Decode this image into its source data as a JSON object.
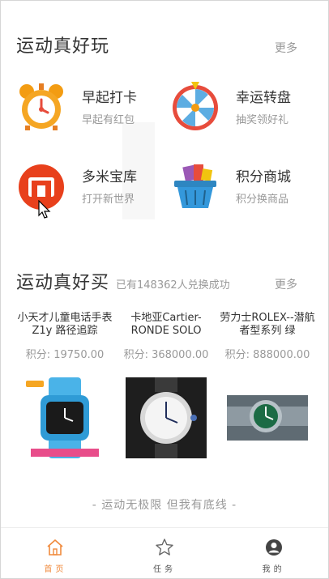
{
  "section_fun": {
    "title": "运动真好玩",
    "more": "更多",
    "items": [
      {
        "name": "早起打卡",
        "desc": "早起有红包",
        "icon": "alarm-clock-icon"
      },
      {
        "name": "幸运转盘",
        "desc": "抽奖领好礼",
        "icon": "lucky-wheel-icon"
      },
      {
        "name": "多米宝库",
        "desc": "打开新世界",
        "icon": "treasure-icon"
      },
      {
        "name": "积分商城",
        "desc": "积分换商品",
        "icon": "shopping-basket-icon"
      }
    ]
  },
  "section_buy": {
    "title": "运动真好买",
    "subtitle": "已有148362人兑换成功",
    "more": "更多",
    "products": [
      {
        "name": "小天才儿童电话手表 Z1y 路径追踪",
        "price": "积分: 19750.00",
        "icon": "kids-smartwatch-image"
      },
      {
        "name": "卡地亚Cartier-RONDE SOLO",
        "price": "积分: 368000.00",
        "icon": "cartier-watch-image"
      },
      {
        "name": "劳力士ROLEX--潜航者型系列 绿",
        "price": "积分: 888000.00",
        "icon": "rolex-watch-image"
      }
    ]
  },
  "slogan": "- 运动无极限 但我有底线 -",
  "tabs": [
    {
      "label": "首页",
      "icon": "home-icon",
      "active": true
    },
    {
      "label": "任务",
      "icon": "star-icon",
      "active": false
    },
    {
      "label": "我的",
      "icon": "user-icon",
      "active": false
    }
  ],
  "colors": {
    "accent": "#f08a3c",
    "text": "#333333",
    "muted": "#999999"
  }
}
